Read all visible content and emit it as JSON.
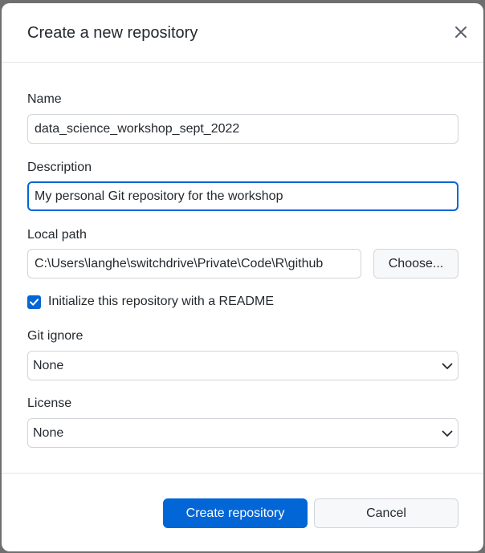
{
  "dialog": {
    "title": "Create a new repository",
    "close_icon": "close-icon"
  },
  "form": {
    "name": {
      "label": "Name",
      "value": "data_science_workshop_sept_2022"
    },
    "description": {
      "label": "Description",
      "value": "My personal Git repository for the workshop"
    },
    "local_path": {
      "label": "Local path",
      "value": "C:\\Users\\langhe\\switchdrive\\Private\\Code\\R\\github",
      "choose_label": "Choose..."
    },
    "readme": {
      "label": "Initialize this repository with a README",
      "checked": true
    },
    "git_ignore": {
      "label": "Git ignore",
      "selected": "None"
    },
    "license": {
      "label": "License",
      "selected": "None"
    }
  },
  "footer": {
    "create_label": "Create repository",
    "cancel_label": "Cancel"
  },
  "colors": {
    "accent": "#0366d6",
    "border": "#d1d5da",
    "text": "#24292e"
  }
}
